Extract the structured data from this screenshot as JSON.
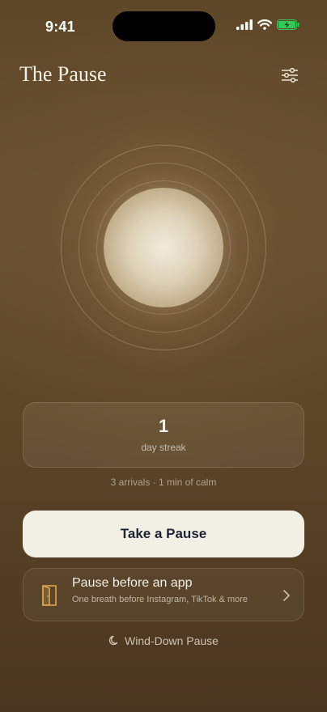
{
  "status_bar": {
    "time": "9:41"
  },
  "header": {
    "title": "The Pause",
    "settings_icon": "sliders-icon"
  },
  "streak": {
    "value": "1",
    "label": "day streak"
  },
  "summary": "3 arrivals · 1 min of calm",
  "primary_action": {
    "label": "Take a Pause"
  },
  "app_pause": {
    "title": "Pause before an app",
    "subtitle": "One breath before Instagram, TikTok & more",
    "icon": "door-icon"
  },
  "wind_down": {
    "label": "Wind-Down Pause",
    "icon": "moon-icon"
  },
  "colors": {
    "background": "#5e4728",
    "primary_button": "#f2efe4",
    "primary_text": "#1c2433",
    "door_accent": "#d9a54a",
    "battery": "#34c759"
  }
}
